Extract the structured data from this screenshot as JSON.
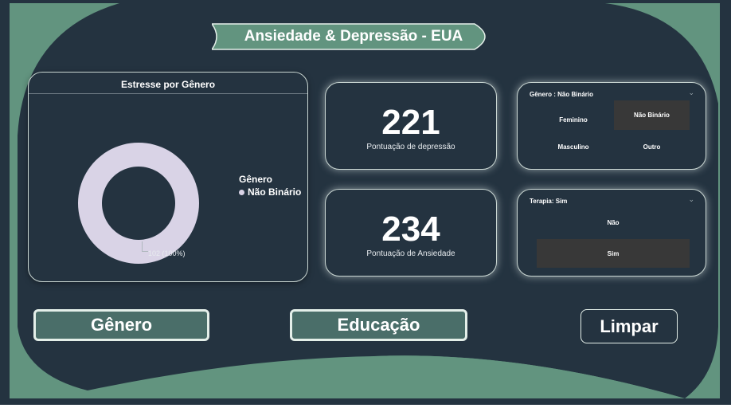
{
  "title": "Ansiedade & Depressão - EUA",
  "colors": {
    "background": "#243340",
    "accent": "#62947f",
    "button_fill": "#4a6e69",
    "donut": "#d9d3e6",
    "selected": "#383838"
  },
  "stress_card": {
    "title": "Estresse por Gênero",
    "legend_title": "Gênero",
    "legend_items": [
      "Não Binário"
    ],
    "data_label": "102 (100%)"
  },
  "chart_data": {
    "type": "pie",
    "title": "Estresse por Gênero",
    "legend_title": "Gênero",
    "categories": [
      "Não Binário"
    ],
    "values": [
      102
    ],
    "labels": [
      "102 (100%)"
    ],
    "legend_placement": "right"
  },
  "kpis": [
    {
      "value": "221",
      "label": "Pontuação de depressão"
    },
    {
      "value": "234",
      "label": "Pontuação de Ansiedade"
    }
  ],
  "gender_slicer": {
    "header": "Gênero : Não Binário",
    "options": [
      "Feminino",
      "Não Binário",
      "Masculino",
      "Outro"
    ],
    "selected": "Não Binário"
  },
  "therapy_slicer": {
    "header": "Terapia: Sim",
    "options": [
      "Não",
      "Sim"
    ],
    "selected": "Sim"
  },
  "buttons": {
    "genero": "Gênero",
    "educacao": "Educação",
    "limpar": "Limpar"
  }
}
